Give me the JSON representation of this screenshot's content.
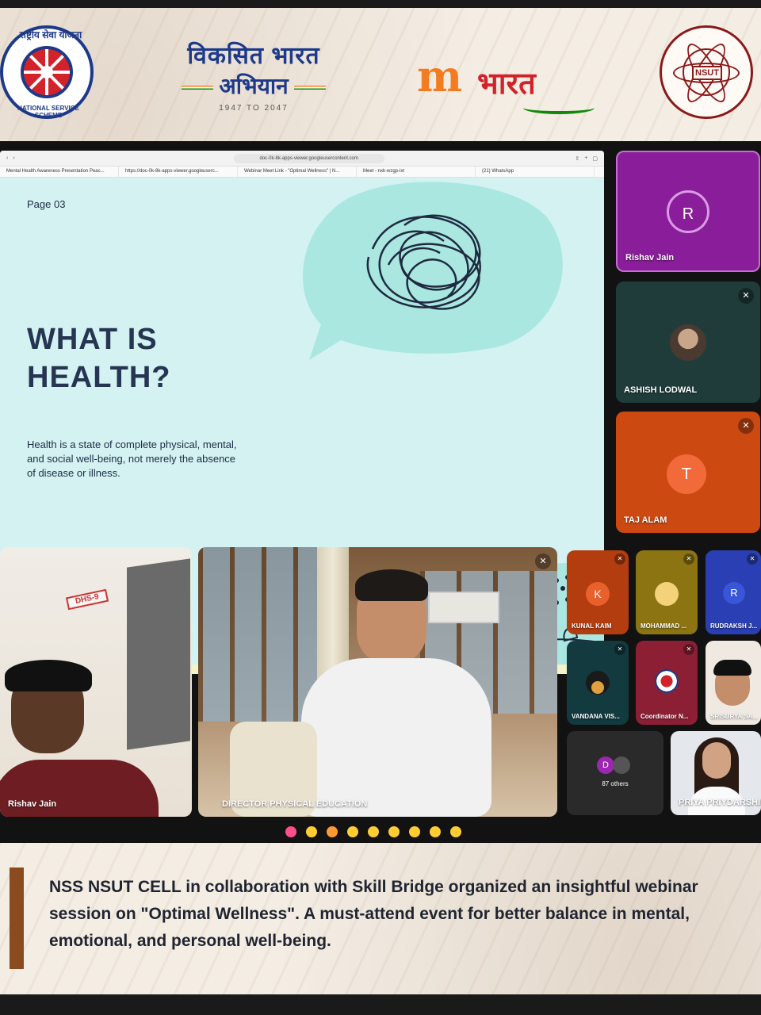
{
  "logos": {
    "nss": {
      "name": "National Service Scheme",
      "hindi": "राष्ट्रीय सेवा योजना",
      "english": "NATIONAL SERVICE SCHEME"
    },
    "viksit_bharat": {
      "line1": "विकसित भारत",
      "line2": "अभियान",
      "years": "1947 TO 2047"
    },
    "my_bharat": {
      "m": "m",
      "text": "भारत"
    },
    "nsut": {
      "abbr": "NSUT",
      "name": "NETAJI SUBHAS UNIVERSITY OF TECHNOLOGY"
    }
  },
  "browser": {
    "url": "doc-0k-8k-apps-viewer.googleusercontent.com",
    "tabs": [
      "Mental Health Awareness Presentation Peac...",
      "https://doc-0k-8k-apps-viewer.googleuserc...",
      "Webinar Meet Link - \"Optimal Wellness\" | N...",
      "Meet - nxk-wzgp-ixt",
      "(21) WhatsApp"
    ]
  },
  "slide": {
    "page_label": "Page 03",
    "title_line1": "WHAT IS",
    "title_line2": "HEALTH?",
    "body": "Health is a state of complete physical, mental, and social well-being, not merely the absence of disease or illness."
  },
  "participants": {
    "rishav_top": {
      "name": "Rishav Jain",
      "initial": "R",
      "color": "#8a1e9a"
    },
    "ashish": {
      "name": "ASHISH LODWAL"
    },
    "taj": {
      "name": "TAJ ALAM",
      "initial": "T",
      "color": "#cc4a12"
    },
    "rishav_video": {
      "name": "Rishav Jain",
      "wall_sign": "DHS-9"
    },
    "director": {
      "name": "DIRECTOR PHYSICAL EDUCATION"
    },
    "kunal": {
      "name": "KUNAL KAIM",
      "initial": "K"
    },
    "mohammad": {
      "name": "MOHAMMAD ..."
    },
    "rudraksh": {
      "name": "RUDRAKSH J...",
      "initial": "R"
    },
    "vandana": {
      "name": "VANDANA VIS..."
    },
    "coordinator": {
      "name": "Coordinator N..."
    },
    "srisurya": {
      "name": "SRISURYA SA..."
    },
    "others": {
      "initial": "D",
      "label": "87 others"
    },
    "priya": {
      "name": "PRIYA PRIYDARSHINI"
    }
  },
  "reactions": [
    "heart",
    "thumbs-up",
    "party",
    "clap",
    "laugh",
    "surprised",
    "sad",
    "thinking",
    "thumbs-down"
  ],
  "caption": {
    "text": "NSS NSUT CELL in collaboration with Skill Bridge organized an insightful webinar session on \"Optimal Wellness\". A must-attend event for better balance in mental, emotional, and personal well-being."
  },
  "colors": {
    "caption_bar": "#8a4b1e",
    "slide_bg": "#d3f2f1",
    "slide_title": "#263552"
  }
}
